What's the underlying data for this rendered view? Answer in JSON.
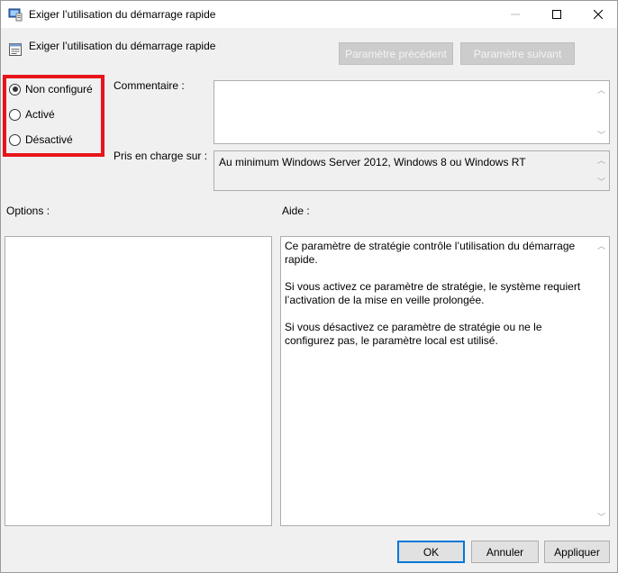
{
  "window": {
    "title": "Exiger l’utilisation du démarrage rapide",
    "icon": "policy-app-icon",
    "controls": {
      "minimize": "—",
      "maximize": "☐",
      "close": "✕"
    }
  },
  "header": {
    "title": "Exiger l’utilisation du démarrage rapide",
    "icon": "setting-page-icon",
    "prev_label": "Paramètre précédent",
    "next_label": "Paramètre suivant"
  },
  "state": {
    "options": [
      {
        "label": "Non configuré",
        "checked": true
      },
      {
        "label": "Activé",
        "checked": false
      },
      {
        "label": "Désactivé",
        "checked": false
      }
    ]
  },
  "comment": {
    "label": "Commentaire :",
    "value": ""
  },
  "supported": {
    "label": "Pris en charge sur :",
    "value": "Au minimum Windows Server 2012, Windows 8 ou Windows RT"
  },
  "options_panel": {
    "label": "Options :"
  },
  "help_panel": {
    "label": "Aide :",
    "paragraphs": [
      "Ce paramètre de stratégie contrôle l’utilisation du démarrage rapide.",
      "Si vous activez ce paramètre de stratégie, le système requiert l’activation de la mise en veille prolongée.",
      "Si vous désactivez ce paramètre de stratégie ou ne le configurez pas, le paramètre local est utilisé."
    ]
  },
  "footer": {
    "ok": "OK",
    "cancel": "Annuler",
    "apply": "Appliquer"
  },
  "colors": {
    "highlight": "#e8141c",
    "accent": "#0078d7"
  }
}
